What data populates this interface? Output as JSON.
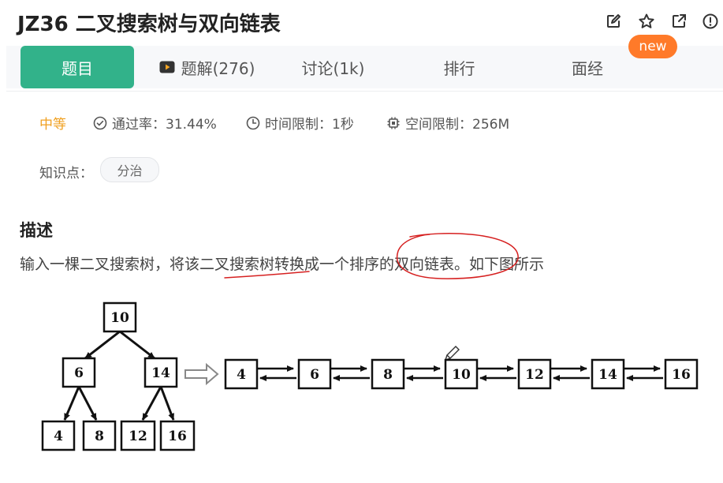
{
  "header": {
    "title": "JZ36  二叉搜索树与双向链表",
    "icons": [
      "edit-icon",
      "star-icon",
      "external-link-icon",
      "info-icon"
    ]
  },
  "tabs": [
    {
      "label": "题目",
      "active": true
    },
    {
      "label": "题解(276)",
      "icon": "video-icon"
    },
    {
      "label": "讨论(1k)"
    },
    {
      "label": "排行"
    },
    {
      "label": "面经"
    }
  ],
  "new_badge": "new",
  "meta": {
    "difficulty": "中等",
    "pass_rate": "通过率：31.44%",
    "time_limit": "时间限制：1秒",
    "space_limit": "空间限制：256M"
  },
  "knowledge": {
    "label": "知识点：",
    "tags": [
      "分治"
    ]
  },
  "description": {
    "title": "描述",
    "text": "输入一棵二叉搜索树，将该二叉搜索树转换成一个排序的双向链表。如下图所示"
  },
  "diagram": {
    "tree": {
      "root": "10",
      "level1": [
        "6",
        "14"
      ],
      "level2": [
        "4",
        "8",
        "12",
        "16"
      ]
    },
    "list": [
      "4",
      "6",
      "8",
      "10",
      "12",
      "14",
      "16"
    ]
  },
  "colors": {
    "accent": "#32b28a",
    "badge": "#ff7a29",
    "difficulty": "#f0a020",
    "annotation": "#d62020"
  }
}
